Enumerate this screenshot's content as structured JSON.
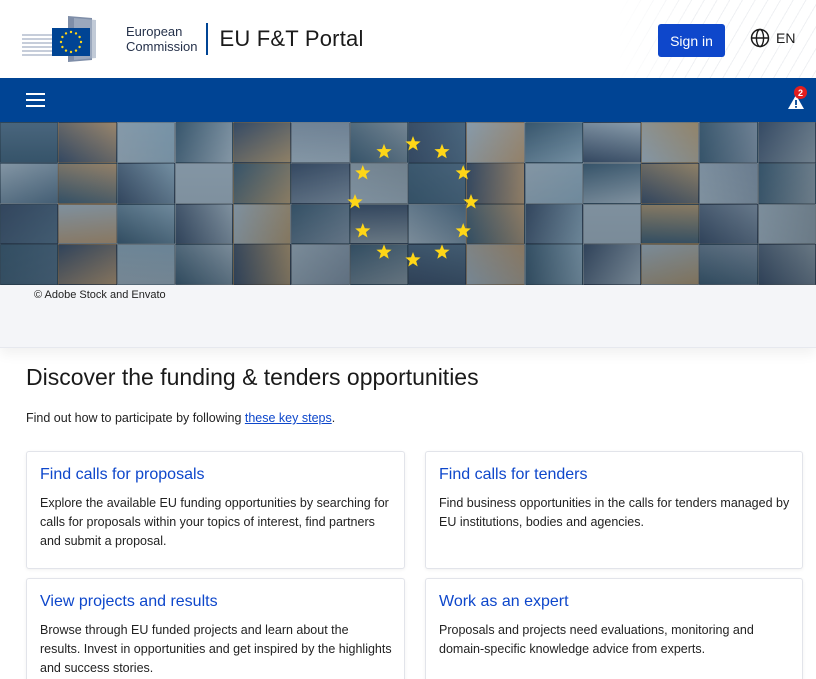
{
  "header": {
    "logo_line1": "European",
    "logo_line2": "Commission",
    "portal_title": "EU F&T Portal",
    "signin_label": "Sign in",
    "language": "EN"
  },
  "nav": {
    "alert_count": "2"
  },
  "banner": {
    "credit": "© Adobe Stock and Envato"
  },
  "main": {
    "heading": "Discover the funding & tenders opportunities",
    "intro_prefix": "Find out how to participate by following ",
    "intro_link": "these key steps",
    "intro_suffix": ".",
    "cards": [
      {
        "title": "Find calls for proposals",
        "text": "Explore the available EU funding opportunities by searching for calls for proposals within your topics of interest, find partners and submit a proposal."
      },
      {
        "title": "Find calls for tenders",
        "text": "Find business opportunities in the calls for tenders managed by EU institutions, bodies and agencies."
      },
      {
        "title": "View projects and results",
        "text": "Browse through EU funded projects and learn about the results. Invest in opportunities and get inspired by the highlights and success stories."
      },
      {
        "title": "Work as an expert",
        "text": "Proposals and projects need evaluations, monitoring and domain-specific knowledge advice from experts."
      }
    ]
  },
  "colors": {
    "primary": "#004494",
    "link": "#0e47cb",
    "star": "#ffd617",
    "alert": "#e21e1e"
  }
}
